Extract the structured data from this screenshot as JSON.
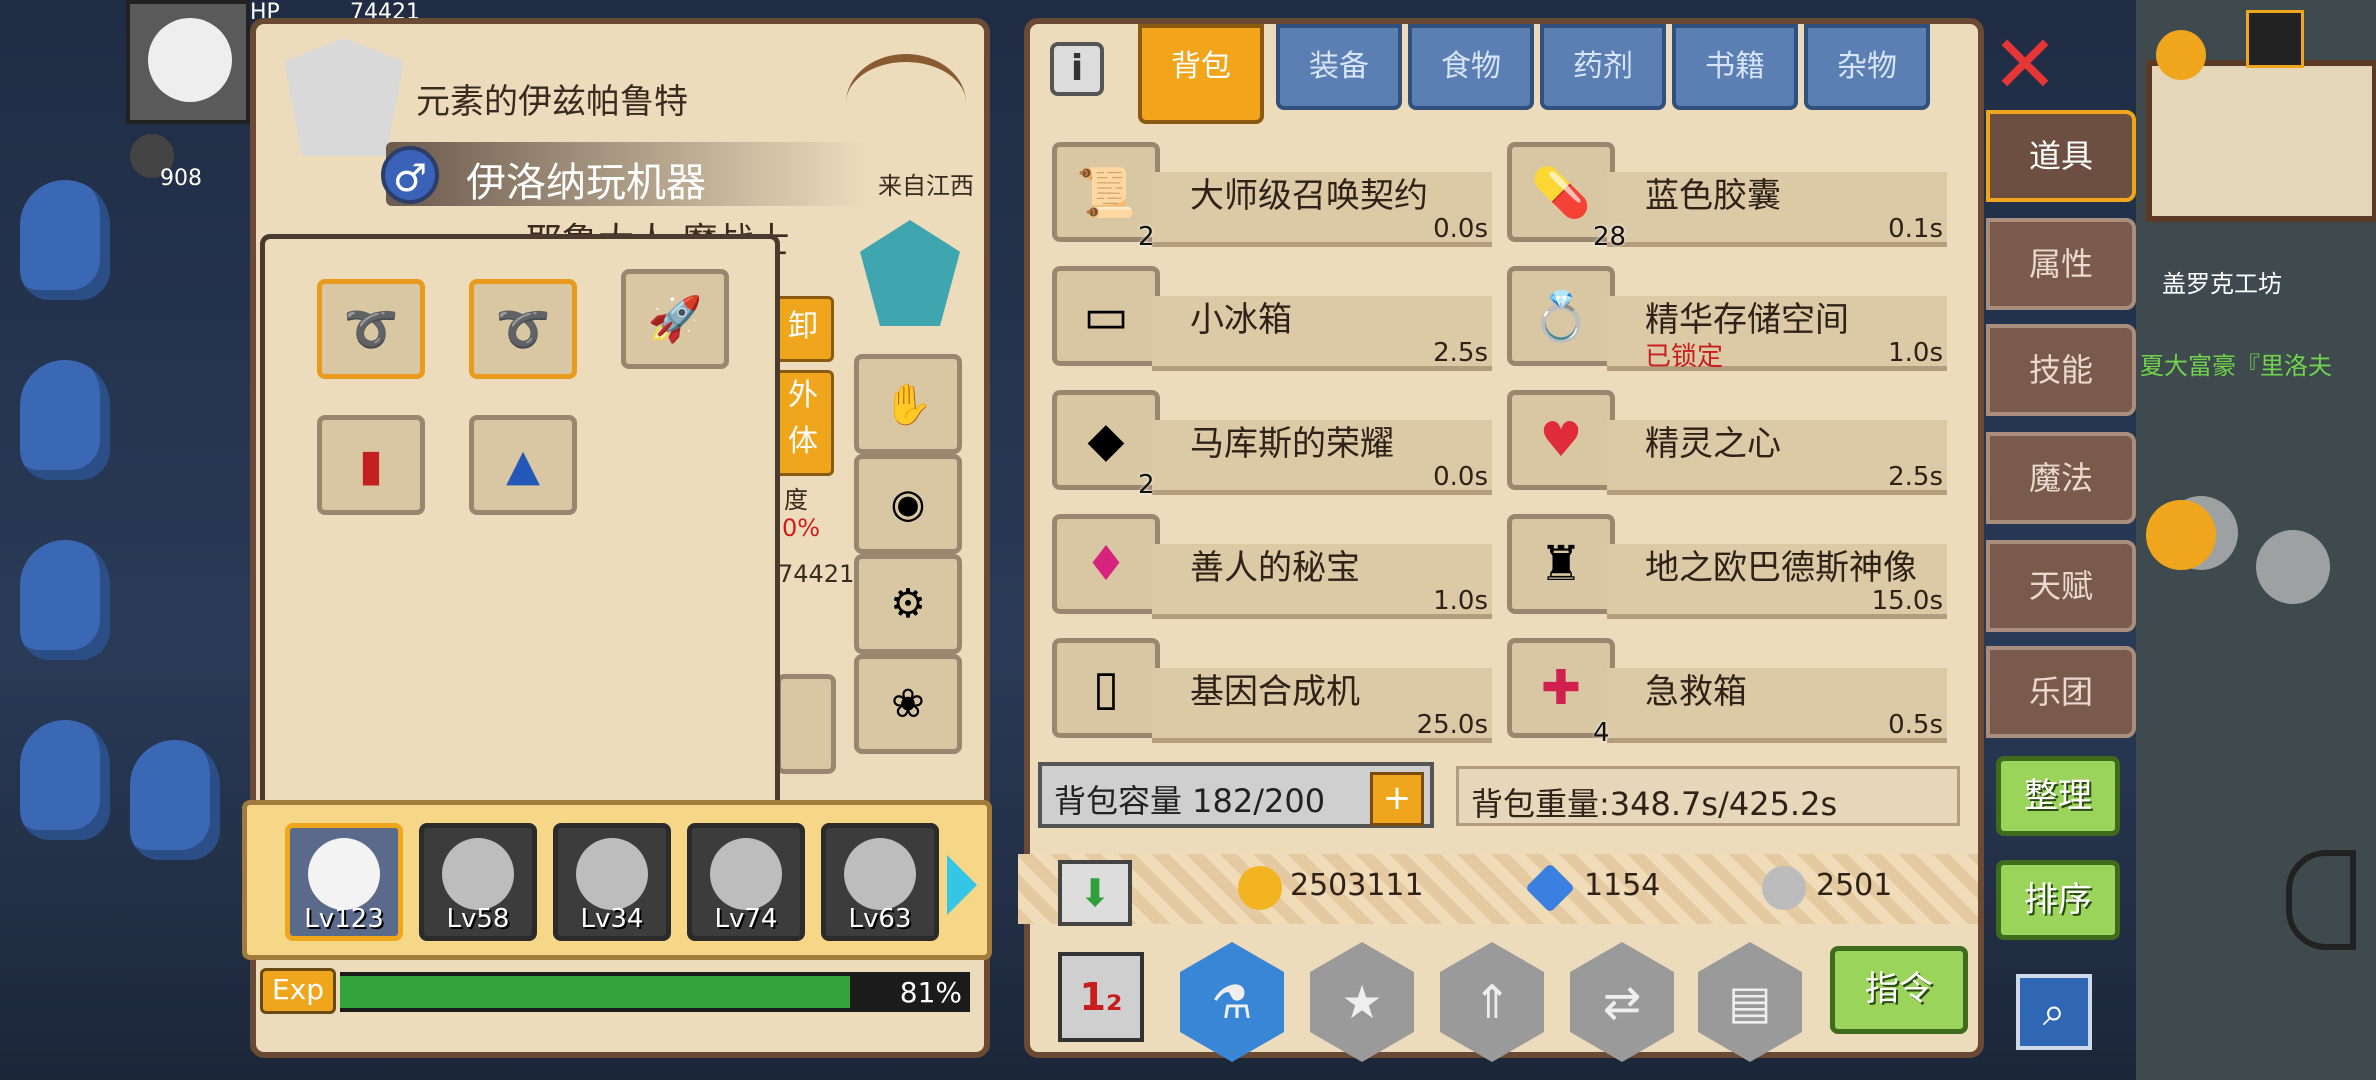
{
  "hud": {
    "hp_label": "HP",
    "hp_value": "74421",
    "stat_value": "908"
  },
  "map": {
    "workshop": "盖罗克工坊",
    "npc_banner": "夏大富豪『里洛夫"
  },
  "character": {
    "title": "元素的伊兹帕鲁特",
    "name": "伊洛纳玩机器",
    "gender_icon": "♂",
    "origin": "来自江西",
    "subtitle": "耶鲁大人 魔战士",
    "unequip_label": "卸",
    "appearance_label": "外\n体",
    "stat_label": "度",
    "stat_pct": "0%",
    "stat_num": "74421"
  },
  "portraits": [
    {
      "level": "Lv123",
      "selected": true
    },
    {
      "level": "Lv58",
      "selected": false
    },
    {
      "level": "Lv34",
      "selected": false
    },
    {
      "level": "Lv74",
      "selected": false
    },
    {
      "level": "Lv63",
      "selected": false
    }
  ],
  "exp": {
    "label": "Exp",
    "percent_text": "81%",
    "fraction": 0.81
  },
  "inventory": {
    "tabs": [
      "背包",
      "装备",
      "食物",
      "药剂",
      "书籍",
      "杂物"
    ],
    "active_tab": 0,
    "items": [
      {
        "name": "大师级召唤契约",
        "time": "0.0s",
        "count": "2",
        "icon": "scroll-icon"
      },
      {
        "name": "蓝色胶囊",
        "time": "0.1s",
        "count": "28",
        "icon": "capsule-icon"
      },
      {
        "name": "小冰箱",
        "time": "2.5s",
        "count": "",
        "icon": "fridge-icon"
      },
      {
        "name": "精华存储空间",
        "time": "1.0s",
        "count": "",
        "locked": "已锁定",
        "icon": "ring-icon"
      },
      {
        "name": "马库斯的荣耀",
        "time": "0.0s",
        "count": "2",
        "icon": "crystal-icon"
      },
      {
        "name": "精灵之心",
        "time": "2.5s",
        "count": "",
        "icon": "heart-icon"
      },
      {
        "name": "善人的秘宝",
        "time": "1.0s",
        "count": "",
        "icon": "gem-icon"
      },
      {
        "name": "地之欧巴德斯神像",
        "time": "15.0s",
        "count": "",
        "icon": "statue-icon"
      },
      {
        "name": "基因合成机",
        "time": "25.0s",
        "count": "",
        "icon": "machine-icon"
      },
      {
        "name": "急救箱",
        "time": "0.5s",
        "count": "4",
        "icon": "firstaid-icon"
      }
    ],
    "capacity_text": "背包容量 182/200",
    "capacity_plus": "+",
    "weight_text": "背包重量:348.7s/425.2s",
    "gold": "2503111",
    "diamonds": "1154",
    "silver": "2501",
    "command_label": "指令"
  },
  "side_tabs": [
    "道具",
    "属性",
    "技能",
    "魔法",
    "天赋",
    "乐团"
  ],
  "side_active": 0,
  "buttons": {
    "organize": "整理",
    "sort": "排序",
    "close": "✕",
    "search": "⌕"
  },
  "colors": {
    "panel": "#ecdcbc",
    "tab_active": "#f2a41b",
    "tab": "#5b7fb2",
    "green_btn": "#9bd45a"
  }
}
